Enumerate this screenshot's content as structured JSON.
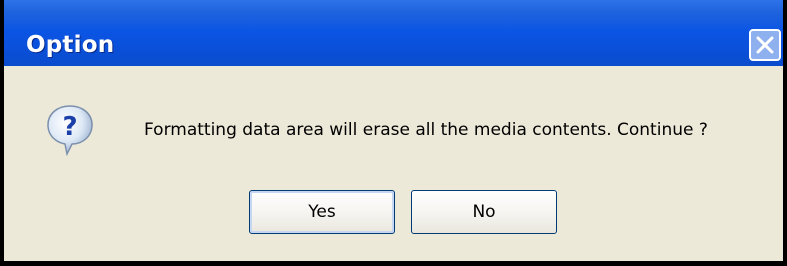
{
  "window": {
    "title": "Option"
  },
  "message": {
    "text": "Formatting data area will erase all the media contents. Continue ?"
  },
  "buttons": {
    "yes_label": "Yes",
    "no_label": "No"
  },
  "icons": {
    "close": "close-icon",
    "question": "question-icon"
  },
  "colors": {
    "titlebar": "#0b55e4",
    "client_background": "#ece9d8",
    "close_button": "#8fb0ee",
    "button_border": "#003c74"
  }
}
